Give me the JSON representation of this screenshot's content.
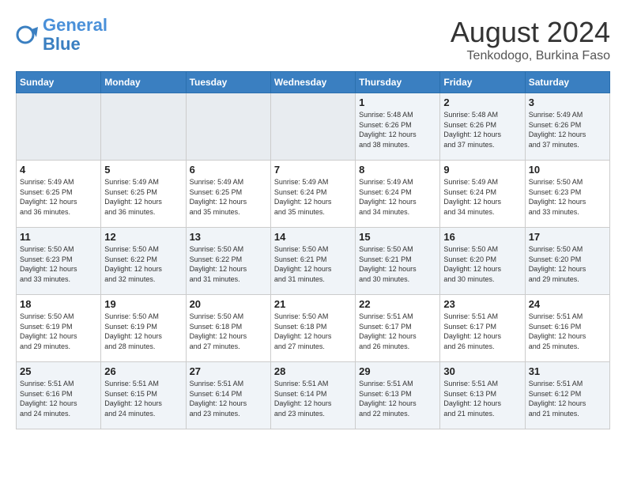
{
  "header": {
    "logo_line1": "General",
    "logo_line2": "Blue",
    "title": "August 2024",
    "subtitle": "Tenkodogo, Burkina Faso"
  },
  "weekdays": [
    "Sunday",
    "Monday",
    "Tuesday",
    "Wednesday",
    "Thursday",
    "Friday",
    "Saturday"
  ],
  "weeks": [
    [
      {
        "day": "",
        "info": ""
      },
      {
        "day": "",
        "info": ""
      },
      {
        "day": "",
        "info": ""
      },
      {
        "day": "",
        "info": ""
      },
      {
        "day": "1",
        "info": "Sunrise: 5:48 AM\nSunset: 6:26 PM\nDaylight: 12 hours\nand 38 minutes."
      },
      {
        "day": "2",
        "info": "Sunrise: 5:48 AM\nSunset: 6:26 PM\nDaylight: 12 hours\nand 37 minutes."
      },
      {
        "day": "3",
        "info": "Sunrise: 5:49 AM\nSunset: 6:26 PM\nDaylight: 12 hours\nand 37 minutes."
      }
    ],
    [
      {
        "day": "4",
        "info": "Sunrise: 5:49 AM\nSunset: 6:25 PM\nDaylight: 12 hours\nand 36 minutes."
      },
      {
        "day": "5",
        "info": "Sunrise: 5:49 AM\nSunset: 6:25 PM\nDaylight: 12 hours\nand 36 minutes."
      },
      {
        "day": "6",
        "info": "Sunrise: 5:49 AM\nSunset: 6:25 PM\nDaylight: 12 hours\nand 35 minutes."
      },
      {
        "day": "7",
        "info": "Sunrise: 5:49 AM\nSunset: 6:24 PM\nDaylight: 12 hours\nand 35 minutes."
      },
      {
        "day": "8",
        "info": "Sunrise: 5:49 AM\nSunset: 6:24 PM\nDaylight: 12 hours\nand 34 minutes."
      },
      {
        "day": "9",
        "info": "Sunrise: 5:49 AM\nSunset: 6:24 PM\nDaylight: 12 hours\nand 34 minutes."
      },
      {
        "day": "10",
        "info": "Sunrise: 5:50 AM\nSunset: 6:23 PM\nDaylight: 12 hours\nand 33 minutes."
      }
    ],
    [
      {
        "day": "11",
        "info": "Sunrise: 5:50 AM\nSunset: 6:23 PM\nDaylight: 12 hours\nand 33 minutes."
      },
      {
        "day": "12",
        "info": "Sunrise: 5:50 AM\nSunset: 6:22 PM\nDaylight: 12 hours\nand 32 minutes."
      },
      {
        "day": "13",
        "info": "Sunrise: 5:50 AM\nSunset: 6:22 PM\nDaylight: 12 hours\nand 31 minutes."
      },
      {
        "day": "14",
        "info": "Sunrise: 5:50 AM\nSunset: 6:21 PM\nDaylight: 12 hours\nand 31 minutes."
      },
      {
        "day": "15",
        "info": "Sunrise: 5:50 AM\nSunset: 6:21 PM\nDaylight: 12 hours\nand 30 minutes."
      },
      {
        "day": "16",
        "info": "Sunrise: 5:50 AM\nSunset: 6:20 PM\nDaylight: 12 hours\nand 30 minutes."
      },
      {
        "day": "17",
        "info": "Sunrise: 5:50 AM\nSunset: 6:20 PM\nDaylight: 12 hours\nand 29 minutes."
      }
    ],
    [
      {
        "day": "18",
        "info": "Sunrise: 5:50 AM\nSunset: 6:19 PM\nDaylight: 12 hours\nand 29 minutes."
      },
      {
        "day": "19",
        "info": "Sunrise: 5:50 AM\nSunset: 6:19 PM\nDaylight: 12 hours\nand 28 minutes."
      },
      {
        "day": "20",
        "info": "Sunrise: 5:50 AM\nSunset: 6:18 PM\nDaylight: 12 hours\nand 27 minutes."
      },
      {
        "day": "21",
        "info": "Sunrise: 5:50 AM\nSunset: 6:18 PM\nDaylight: 12 hours\nand 27 minutes."
      },
      {
        "day": "22",
        "info": "Sunrise: 5:51 AM\nSunset: 6:17 PM\nDaylight: 12 hours\nand 26 minutes."
      },
      {
        "day": "23",
        "info": "Sunrise: 5:51 AM\nSunset: 6:17 PM\nDaylight: 12 hours\nand 26 minutes."
      },
      {
        "day": "24",
        "info": "Sunrise: 5:51 AM\nSunset: 6:16 PM\nDaylight: 12 hours\nand 25 minutes."
      }
    ],
    [
      {
        "day": "25",
        "info": "Sunrise: 5:51 AM\nSunset: 6:16 PM\nDaylight: 12 hours\nand 24 minutes."
      },
      {
        "day": "26",
        "info": "Sunrise: 5:51 AM\nSunset: 6:15 PM\nDaylight: 12 hours\nand 24 minutes."
      },
      {
        "day": "27",
        "info": "Sunrise: 5:51 AM\nSunset: 6:14 PM\nDaylight: 12 hours\nand 23 minutes."
      },
      {
        "day": "28",
        "info": "Sunrise: 5:51 AM\nSunset: 6:14 PM\nDaylight: 12 hours\nand 23 minutes."
      },
      {
        "day": "29",
        "info": "Sunrise: 5:51 AM\nSunset: 6:13 PM\nDaylight: 12 hours\nand 22 minutes."
      },
      {
        "day": "30",
        "info": "Sunrise: 5:51 AM\nSunset: 6:13 PM\nDaylight: 12 hours\nand 21 minutes."
      },
      {
        "day": "31",
        "info": "Sunrise: 5:51 AM\nSunset: 6:12 PM\nDaylight: 12 hours\nand 21 minutes."
      }
    ]
  ]
}
